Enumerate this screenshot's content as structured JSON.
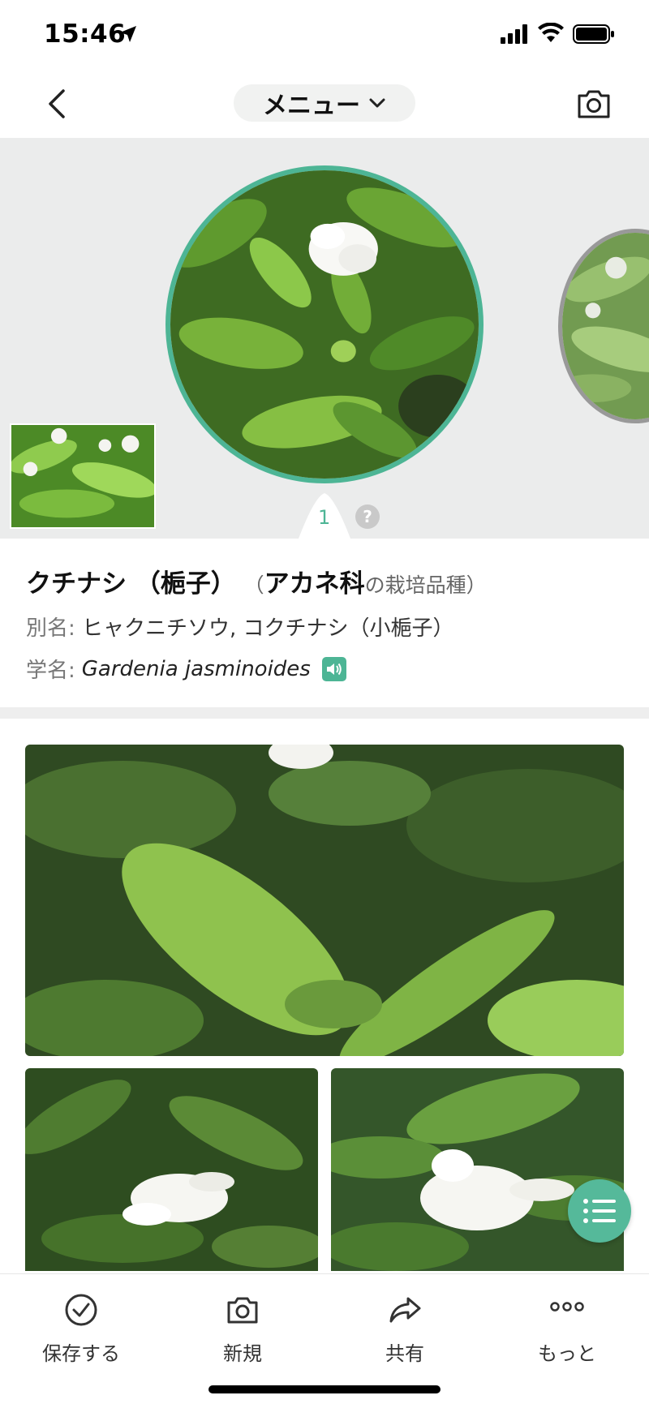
{
  "status": {
    "time": "15:46"
  },
  "nav": {
    "menu_label": "メニュー"
  },
  "carousel": {
    "current_index": "1",
    "help_mark": "?"
  },
  "plant": {
    "name": "クチナシ （梔子）",
    "family_paren_open": "（",
    "family": "アカネ科",
    "family_suffix": "の栽培品種）",
    "alias_label": "別名:",
    "alias_value": "ヒャクニチソウ, コクチナシ（小梔子）",
    "sci_label": "学名:",
    "sci_value": "Gardenia jasminoides"
  },
  "bottom_tabs": [
    {
      "label": "保存する",
      "icon": "check-circle-icon"
    },
    {
      "label": "新規",
      "icon": "camera-icon"
    },
    {
      "label": "共有",
      "icon": "share-arrow-icon"
    },
    {
      "label": "もっと",
      "icon": "more-dots-icon"
    }
  ],
  "colors": {
    "accent": "#4db595",
    "background_strip": "#ebecec"
  }
}
